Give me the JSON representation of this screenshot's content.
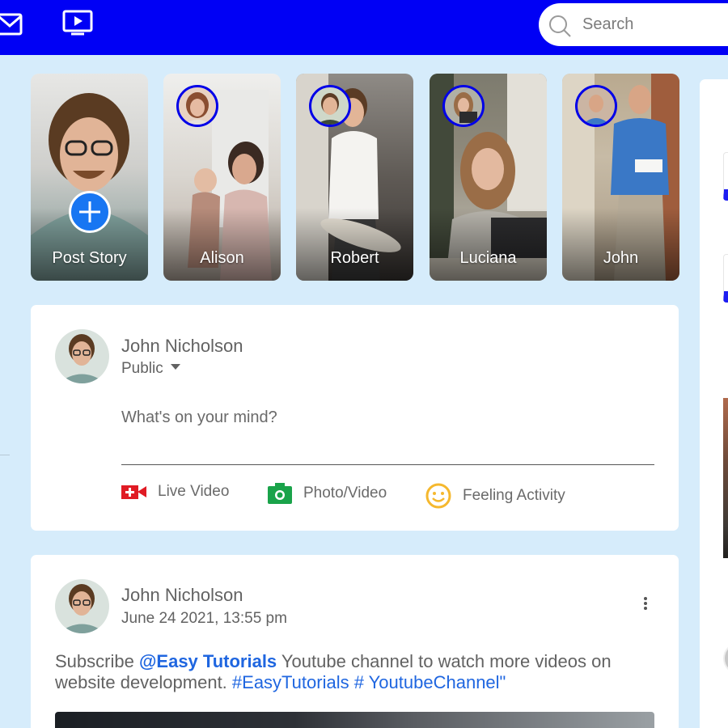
{
  "search": {
    "placeholder": "Search"
  },
  "stories": [
    {
      "name": "Post Story",
      "type": "add"
    },
    {
      "name": "Alison"
    },
    {
      "name": "Robert"
    },
    {
      "name": "Luciana"
    },
    {
      "name": "John"
    }
  ],
  "composer": {
    "user_name": "John Nicholson",
    "privacy": "Public",
    "placeholder": "What's on your mind?",
    "actions": [
      {
        "label": "Live Video",
        "icon": "live-video-icon",
        "color": "#e01b24"
      },
      {
        "label": "Photo/Video",
        "icon": "camera-icon",
        "color": "#1aa34a"
      },
      {
        "label": "Feeling Activity",
        "icon": "smiley-icon",
        "color": "#f5b82e"
      }
    ]
  },
  "post": {
    "user_name": "John Nicholson",
    "date": "June 24 2021, 13:55 pm",
    "text_before": "Subscribe ",
    "mention": "@Easy Tutorials",
    "text_middle": " Youtube channel to watch more videos on website development. ",
    "tags": "#EasyTutorials # YoutubeChannel\""
  },
  "colors": {
    "topbar": "#0000f5",
    "background": "#d6ecfb",
    "link": "#1f66e0",
    "story_ring": "#0000e8",
    "add_button": "#1876f2"
  }
}
